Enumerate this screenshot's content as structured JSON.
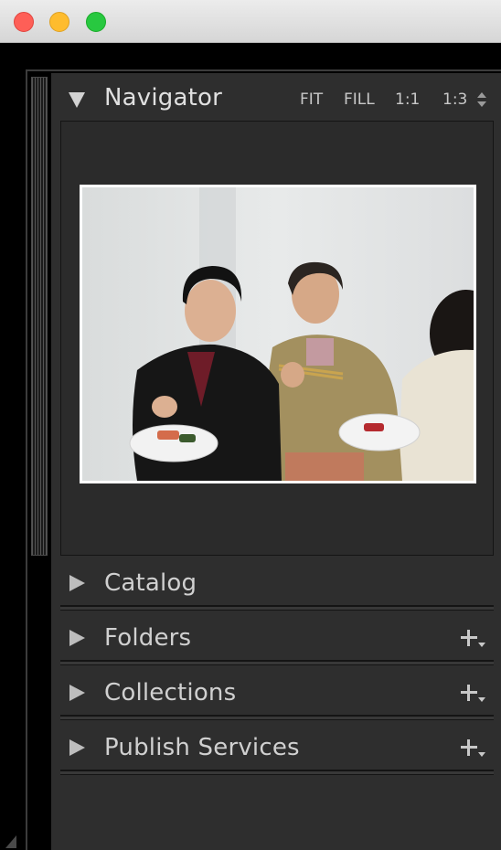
{
  "window": {
    "traffic_lights": {
      "close_color": "#fe5f57",
      "minimize_color": "#febc2e",
      "zoom_color": "#28c840"
    }
  },
  "navigator": {
    "title": "Navigator",
    "zoom_options": [
      "FIT",
      "FILL",
      "1:1",
      "1:3"
    ],
    "preview_image": "photo of two women holding plates of sushi against a white wall"
  },
  "sections": [
    {
      "title": "Catalog",
      "has_add": false,
      "expanded": false
    },
    {
      "title": "Folders",
      "has_add": true,
      "expanded": false
    },
    {
      "title": "Collections",
      "has_add": true,
      "expanded": false
    },
    {
      "title": "Publish Services",
      "has_add": true,
      "expanded": false
    }
  ],
  "icons": {
    "expand": "triangle-right-icon",
    "collapse": "triangle-down-icon",
    "add": "plus-icon",
    "zoom_stepper": "up-down-arrows-icon"
  }
}
